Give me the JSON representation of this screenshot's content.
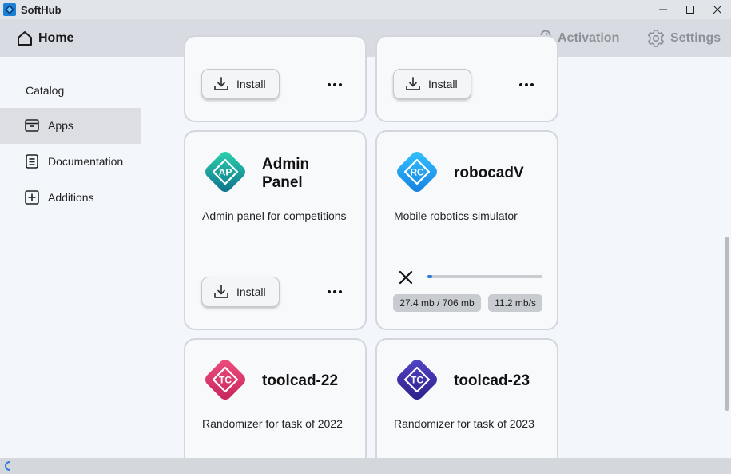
{
  "window": {
    "title": "SoftHub",
    "icons": {
      "logo": "softhub-logo-icon",
      "minimize": "minimize-icon",
      "maximize": "maximize-icon",
      "close": "close-icon"
    }
  },
  "header": {
    "home_label": "Home",
    "activation_label": "Activation",
    "settings_label": "Settings",
    "icons": {
      "home": "home-icon",
      "activation": "key-icon",
      "settings": "gear-icon"
    }
  },
  "sidebar": {
    "heading": "Catalog",
    "items": [
      {
        "label": "Apps",
        "icon": "archive-box-icon",
        "active": true
      },
      {
        "label": "Documentation",
        "icon": "document-icon",
        "active": false
      },
      {
        "label": "Additions",
        "icon": "plus-square-icon",
        "active": false
      }
    ]
  },
  "cards": [
    {
      "install_label": "Install"
    },
    {
      "install_label": "Install"
    },
    {
      "name_line1": "Admin",
      "name_line2": "Panel",
      "icon_text": "AP",
      "description": "Admin panel for competitions",
      "install_label": "Install"
    },
    {
      "name": "robocadV",
      "icon_text": "RC",
      "description": "Mobile robotics simulator",
      "download": {
        "progress": 0.04,
        "size_text": "27.4 mb / 706 mb",
        "speed_text": "11.2 mb/s"
      }
    },
    {
      "name": "toolcad-22",
      "icon_text": "TC",
      "description": "Randomizer for task of 2022"
    },
    {
      "name": "toolcad-23",
      "icon_text": "TC",
      "description": "Randomizer for task of 2023"
    }
  ],
  "colors": {
    "admin_panel": "#1bb39a",
    "robocad": "#1e9df0",
    "toolcad_22": "#d8336a",
    "toolcad_23": "#3b2fa0",
    "progress": "#2f78e0"
  }
}
